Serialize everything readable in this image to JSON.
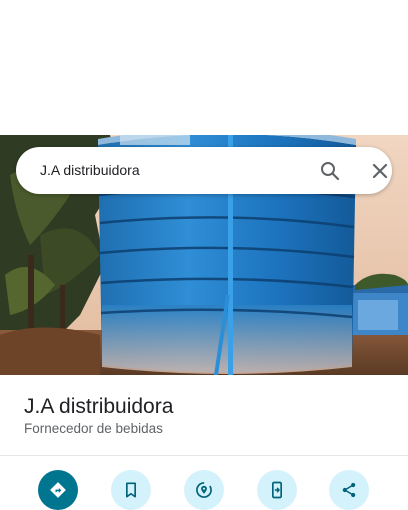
{
  "search": {
    "query": "J.A distribuidora"
  },
  "place": {
    "name": "J.A distribuidora",
    "category": "Fornecedor de bebidas"
  },
  "actions": [
    {
      "icon": "directions-icon"
    },
    {
      "icon": "bookmark-icon"
    },
    {
      "icon": "nearby-icon"
    },
    {
      "icon": "send-to-phone-icon"
    },
    {
      "icon": "share-icon"
    }
  ],
  "colors": {
    "primary_button": "#00758f",
    "secondary_button": "#d3f2fb",
    "secondary_icon": "#00637a",
    "title_text": "#202124",
    "subtitle_text": "#5f6368"
  }
}
